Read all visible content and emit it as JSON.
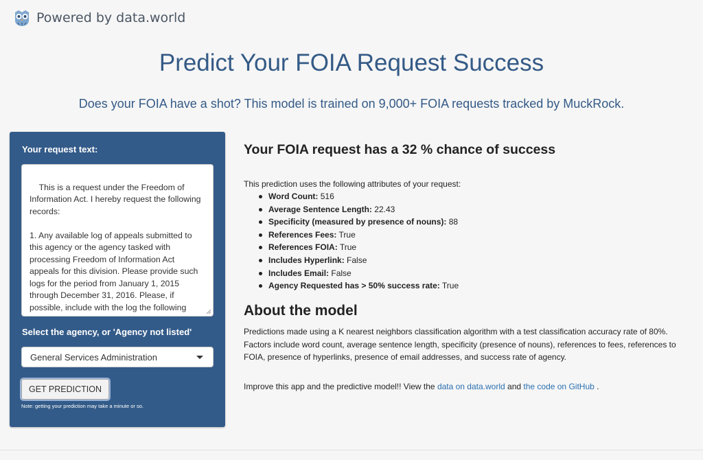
{
  "brand": {
    "text": "Powered by data.world",
    "icon": "owl-logo-icon"
  },
  "header": {
    "title": "Predict Your FOIA Request Success",
    "subtitle": "Does your FOIA have a shot? This model is trained on 9,000+ FOIA requests tracked by MuckRock."
  },
  "sidebar": {
    "request_label": "Your request text:",
    "request_value": "This is a request under the Freedom of Information Act. I hereby request the following records:\n\n1. Any available log of appeals submitted to this agency or the agency tasked with processing Freedom of Information Act appeals for this division. Please provide such logs for the period from January 1, 2015 through December 31, 2016. Please, if possible, include with the log the following items:",
    "agency_label": "Select the agency, or 'Agency not listed'",
    "agency_selected": "General Services Administration",
    "button_label": "GET PREDICTION",
    "note": "Note: getting your prediction may take a minute or so."
  },
  "result": {
    "heading": "Your FOIA request has a 32 % chance of success",
    "intro": "This prediction uses the following attributes of your request:",
    "attributes": [
      {
        "label": "Word Count:",
        "value": " 516"
      },
      {
        "label": "Average Sentence Length:",
        "value": " 22.43"
      },
      {
        "label": "Specificity (measured by presence of nouns):",
        "value": " 88"
      },
      {
        "label": "References Fees:",
        "value": " True"
      },
      {
        "label": "References FOIA:",
        "value": " True"
      },
      {
        "label": "Includes Hyperlink:",
        "value": " False"
      },
      {
        "label": "Includes Email:",
        "value": " False"
      },
      {
        "label": "Agency Requested has > 50% success rate:",
        "value": " True"
      }
    ]
  },
  "about": {
    "heading": "About the model",
    "body": "Predictions made using a K nearest neighbors classification algorithm with a test classification accuracy rate of 80%. Factors include word count, average sentence length, specificity (presence of nouns), references to fees, references to FOIA, presence of hyperlinks, presence of email addresses, and success rate of agency.",
    "improve_prefix": "Improve this app and the predictive model!! View the ",
    "link_data": "data on data.world",
    "improve_and": " and ",
    "link_code": "the code on GitHub",
    "improve_suffix": " ."
  },
  "colors": {
    "accent": "#345a86",
    "panel": "#335b89",
    "link": "#2a6fb0"
  }
}
